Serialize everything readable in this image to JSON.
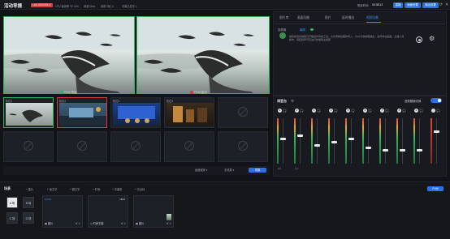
{
  "app": {
    "title": "活动导播",
    "badge": "LA3-000VS517"
  },
  "stats": [
    {
      "label": "CPU 使用率 92.14%"
    },
    {
      "label": "网速 0kbs"
    },
    {
      "label": "帧数 0帧_0"
    },
    {
      "label": "字幕已发布 1"
    }
  ],
  "topright": {
    "timer_label": "剩余时间",
    "timer": "00:38:12",
    "start_label": "直播",
    "layout_label": "画面设置",
    "output_label": "输出设置"
  },
  "preview": {
    "pvw_label": "PVW 预监",
    "pgm_label": "PGM 监出"
  },
  "sources": {
    "row1": [
      {
        "label": "机位1"
      },
      {
        "label": "机位2"
      },
      {
        "label": "机位3"
      },
      {
        "label": "机位4"
      },
      {
        "label": ""
      }
    ],
    "row2": [
      {
        "label": ""
      },
      {
        "label": ""
      },
      {
        "label": ""
      },
      {
        "label": ""
      },
      {
        "label": ""
      }
    ]
  },
  "pvwbar": {
    "select1": "画面缩放",
    "select2": "无效果",
    "cut": "切换"
  },
  "panel": {
    "tabs": [
      "图片库",
      "画面功能",
      "贴片",
      "延时播出",
      "视频功能"
    ],
    "active_tab": 4,
    "subtab1": "抠像器",
    "subtab2": "编辑",
    "desc": "编辑使用并编辑可开播后时间的工具，允许录制后期的导入，为22分钟编辑播出，操作并在画面，主播人员操作，调控频率节目进行的编辑主题即"
  },
  "audio": {
    "title": "调音台",
    "follow_label": "音频跟随切换",
    "channels": [
      {
        "num": "1",
        "tag": "机1",
        "level": 0.55
      },
      {
        "num": "2",
        "tag": "机2",
        "level": 0.62
      },
      {
        "num": "3",
        "tag": "",
        "level": 0.4
      },
      {
        "num": "4",
        "tag": "",
        "level": 0.48
      },
      {
        "num": "5",
        "tag": "",
        "level": 0.55
      },
      {
        "num": "6",
        "tag": "",
        "level": 0.35
      },
      {
        "num": "7",
        "tag": "",
        "level": 0.3
      },
      {
        "num": "8",
        "tag": "",
        "level": 0.3
      },
      {
        "num": "9",
        "tag": "",
        "level": 0.3
      },
      {
        "num": "",
        "tag": "",
        "level": 0.7
      }
    ]
  },
  "scene": {
    "title": "场景",
    "toolbar": [
      "图片",
      "画文字",
      "图文字",
      "时间",
      "字幕条",
      "去台标"
    ],
    "pvw_label": "PVW",
    "slots": [
      "A 场",
      "B 场",
      "C 场",
      "D 场"
    ],
    "cards": [
      {
        "label": "图片",
        "tag": "LOGO"
      },
      {
        "label": "时间字幕",
        "tag": "NEW"
      },
      {
        "label": "图片",
        "tag": ""
      }
    ]
  },
  "colors": {
    "accent": "#2f6fe6",
    "pvw": "#2fb35a",
    "pgm": "#d23d3d",
    "active_tab": "#3f8cff"
  }
}
